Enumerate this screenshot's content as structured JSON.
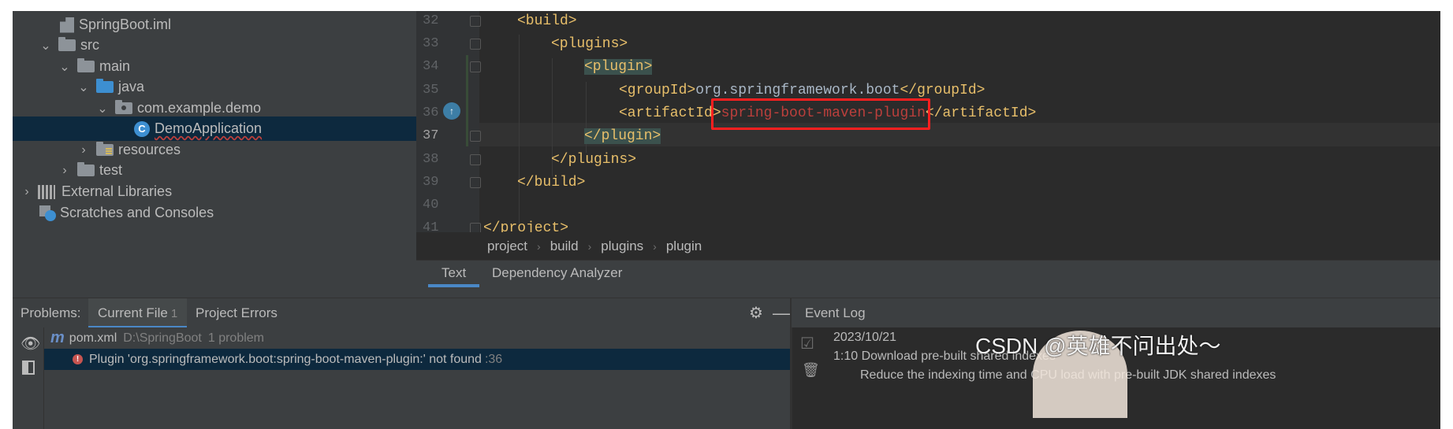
{
  "project_tree": [
    {
      "label": "SpringBoot.iml",
      "icon": "iml-file-icon"
    },
    {
      "label": "src",
      "icon": "folder-icon",
      "expanded": true
    },
    {
      "label": "main",
      "icon": "folder-icon",
      "expanded": true
    },
    {
      "label": "java",
      "icon": "source-folder-icon",
      "expanded": true
    },
    {
      "label": "com.example.demo",
      "icon": "package-icon",
      "expanded": true
    },
    {
      "label": "DemoApplication",
      "icon": "spring-class-icon",
      "selected": true
    },
    {
      "label": "resources",
      "icon": "resources-folder-icon",
      "expanded": false
    },
    {
      "label": "test",
      "icon": "folder-icon",
      "expanded": false
    },
    {
      "label": "External Libraries",
      "icon": "libraries-icon",
      "expanded": false
    },
    {
      "label": "Scratches and Consoles",
      "icon": "scratches-icon"
    }
  ],
  "editor": {
    "line_numbers": [
      "32",
      "33",
      "34",
      "35",
      "36",
      "37",
      "38",
      "39",
      "40",
      "41"
    ],
    "current_line": "37",
    "lines": {
      "l32": "<build>",
      "l33": "<plugins>",
      "l34": "<plugin>",
      "l35_open": "<groupId>",
      "l35_value": "org.springframework.boot",
      "l35_close": "</groupId>",
      "l36_open": "<artifactId",
      "l36_gt": ">",
      "l36_value": "spring-boot-maven-plugin",
      "l36_close": "</artifactId>",
      "l37": "</plugin>",
      "l38": "</plugins>",
      "l39": "</build>",
      "l41": "</project>"
    },
    "highlight_color": "#ff1f1f"
  },
  "breadcrumb": [
    "project",
    "build",
    "plugins",
    "plugin"
  ],
  "editor_tabs": {
    "text": "Text",
    "dependency": "Dependency Analyzer"
  },
  "problems": {
    "label": "Problems:",
    "tabs": {
      "current_file": "Current File",
      "current_file_count": "1",
      "project_errors": "Project Errors"
    },
    "file_name": "pom.xml",
    "file_path": "D:\\SpringBoot",
    "file_summary": "1 problem",
    "error_message": "Plugin 'org.springframework.boot:spring-boot-maven-plugin:' not found",
    "error_line": ":36"
  },
  "event_log": {
    "title": "Event Log",
    "date": "2023/10/21",
    "entry": "1:10 Download pre-built shared indexes",
    "entry_detail": "Reduce the indexing time and CPU load with pre-built JDK shared indexes"
  },
  "watermark": "CSDN @英雄不问出处～"
}
